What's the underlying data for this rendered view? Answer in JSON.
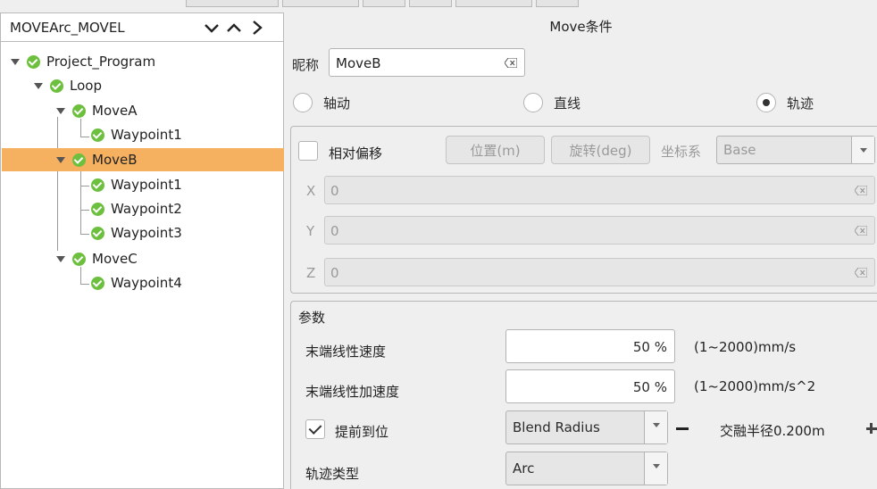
{
  "tree": {
    "header_title": "MOVEArc_MOVEL",
    "header_icons": [
      "chevron-down-icon",
      "chevron-up-icon",
      "chevron-right-icon"
    ],
    "nodes": [
      {
        "label": "Project_Program"
      },
      {
        "label": "Loop"
      },
      {
        "label": "MoveA"
      },
      {
        "label": "Waypoint1"
      },
      {
        "label": "MoveB"
      },
      {
        "label": "Waypoint1"
      },
      {
        "label": "Waypoint2"
      },
      {
        "label": "Waypoint3"
      },
      {
        "label": "MoveC"
      },
      {
        "label": "Waypoint4"
      }
    ],
    "selected": "MoveB"
  },
  "move": {
    "title": "Move条件",
    "nickname_label": "昵称",
    "nickname_value": "MoveB",
    "radios": [
      {
        "label": "轴动",
        "checked": false
      },
      {
        "label": "直线",
        "checked": false
      },
      {
        "label": "轨迹",
        "checked": true
      }
    ]
  },
  "offset": {
    "checkbox_label": "相对偏移",
    "checked": false,
    "position_button": "位置(m)",
    "rotation_button": "旋转(deg)",
    "coord_label": "坐标系",
    "coord_value": "Base",
    "fields": [
      {
        "label": "X",
        "value": "0"
      },
      {
        "label": "Y",
        "value": "0"
      },
      {
        "label": "Z",
        "value": "0"
      }
    ]
  },
  "params": {
    "title": "参数",
    "tcp_speed_label": "末端线性速度",
    "tcp_speed_value": "50 %",
    "tcp_speed_range": "(1~2000)mm/s",
    "tcp_acc_label": "末端线性加速度",
    "tcp_acc_value": "50 %",
    "tcp_acc_range": "(1~2000)mm/s^2",
    "blend_label": "提前到位",
    "blend_checked": true,
    "blend_mode": "Blend Radius",
    "blend_radius_text": "交融半径0.200m",
    "traj_type_label": "轨迹类型",
    "traj_type_value": "Arc"
  },
  "colors": {
    "selected_row": "#f5b160",
    "status_ok": "#6dbf3e"
  }
}
